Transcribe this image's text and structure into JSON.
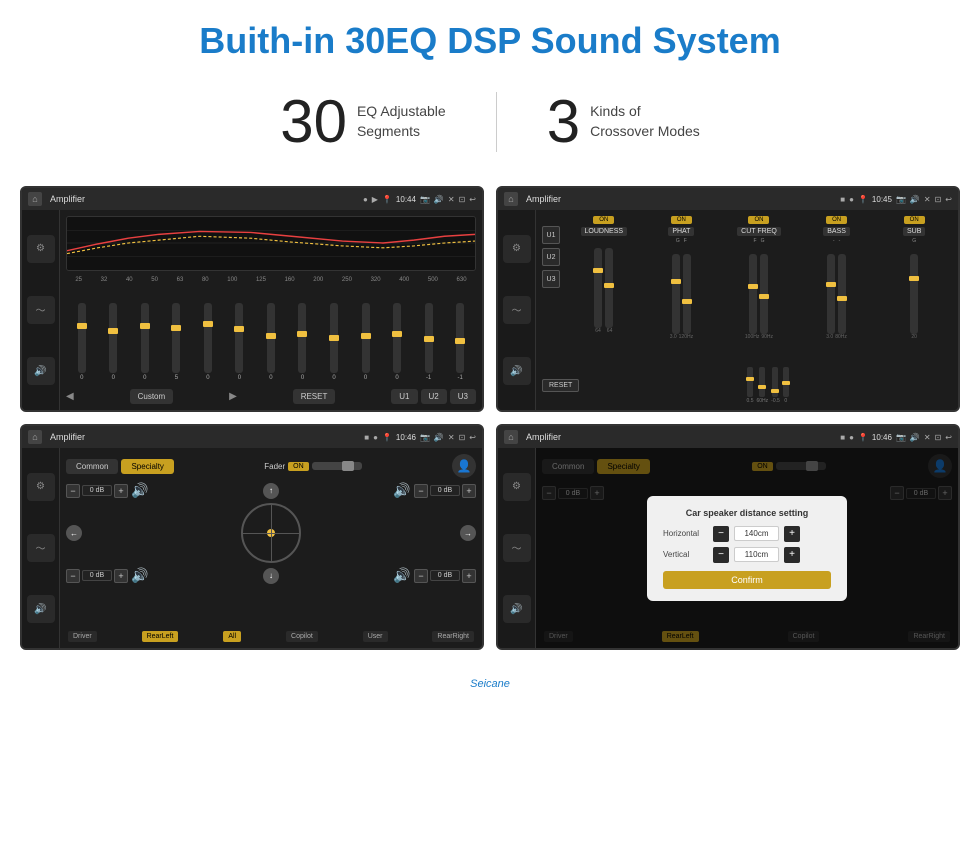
{
  "page": {
    "title": "Buith-in 30EQ DSP Sound System",
    "stats": [
      {
        "number": "30",
        "desc_line1": "EQ Adjustable",
        "desc_line2": "Segments"
      },
      {
        "number": "3",
        "desc_line1": "Kinds of",
        "desc_line2": "Crossover Modes"
      }
    ],
    "watermark": "Seicane"
  },
  "screens": {
    "eq_screen": {
      "title": "Amplifier",
      "time": "10:44",
      "labels": [
        "25",
        "32",
        "40",
        "50",
        "63",
        "80",
        "100",
        "125",
        "160",
        "200",
        "250",
        "320",
        "400",
        "500",
        "630"
      ],
      "values": [
        "0",
        "0",
        "0",
        "5",
        "0",
        "0",
        "0",
        "0",
        "0",
        "0",
        "0",
        "-1",
        "0",
        "-1"
      ],
      "buttons": [
        "Custom",
        "RESET",
        "U1",
        "U2",
        "U3"
      ]
    },
    "crossover_screen": {
      "title": "Amplifier",
      "time": "10:45",
      "units": [
        "LOUDNESS",
        "PHAT",
        "CUT FREQ",
        "BASS",
        "SUB"
      ],
      "u_buttons": [
        "U1",
        "U2",
        "U3"
      ],
      "reset_label": "RESET"
    },
    "speaker_screen1": {
      "title": "Amplifier",
      "time": "10:46",
      "tabs": [
        "Common",
        "Specialty"
      ],
      "fader_label": "Fader",
      "fader_on": "ON",
      "controls": [
        {
          "label": "0 dB"
        },
        {
          "label": "0 dB"
        },
        {
          "label": "0 dB"
        },
        {
          "label": "0 dB"
        }
      ],
      "position_buttons": [
        "Driver",
        "RearLeft",
        "All",
        "Copilot",
        "User",
        "RearRight"
      ]
    },
    "speaker_screen2": {
      "title": "Amplifier",
      "time": "10:46",
      "tabs": [
        "Common",
        "Specialty"
      ],
      "dialog": {
        "title": "Car speaker distance setting",
        "horizontal_label": "Horizontal",
        "horizontal_value": "140cm",
        "vertical_label": "Vertical",
        "vertical_value": "110cm",
        "confirm_label": "Confirm"
      },
      "controls": [
        {
          "label": "0 dB"
        },
        {
          "label": "0 dB"
        }
      ],
      "position_buttons": [
        "Driver",
        "RearLeft",
        "Copilot",
        "RearRight"
      ]
    }
  },
  "icons": {
    "home": "⌂",
    "back": "↩",
    "menu": "≡",
    "play": "▶",
    "prev": "◀",
    "next": "▶",
    "eq": "≋",
    "speaker": "🔊",
    "minus": "−",
    "plus": "+"
  }
}
